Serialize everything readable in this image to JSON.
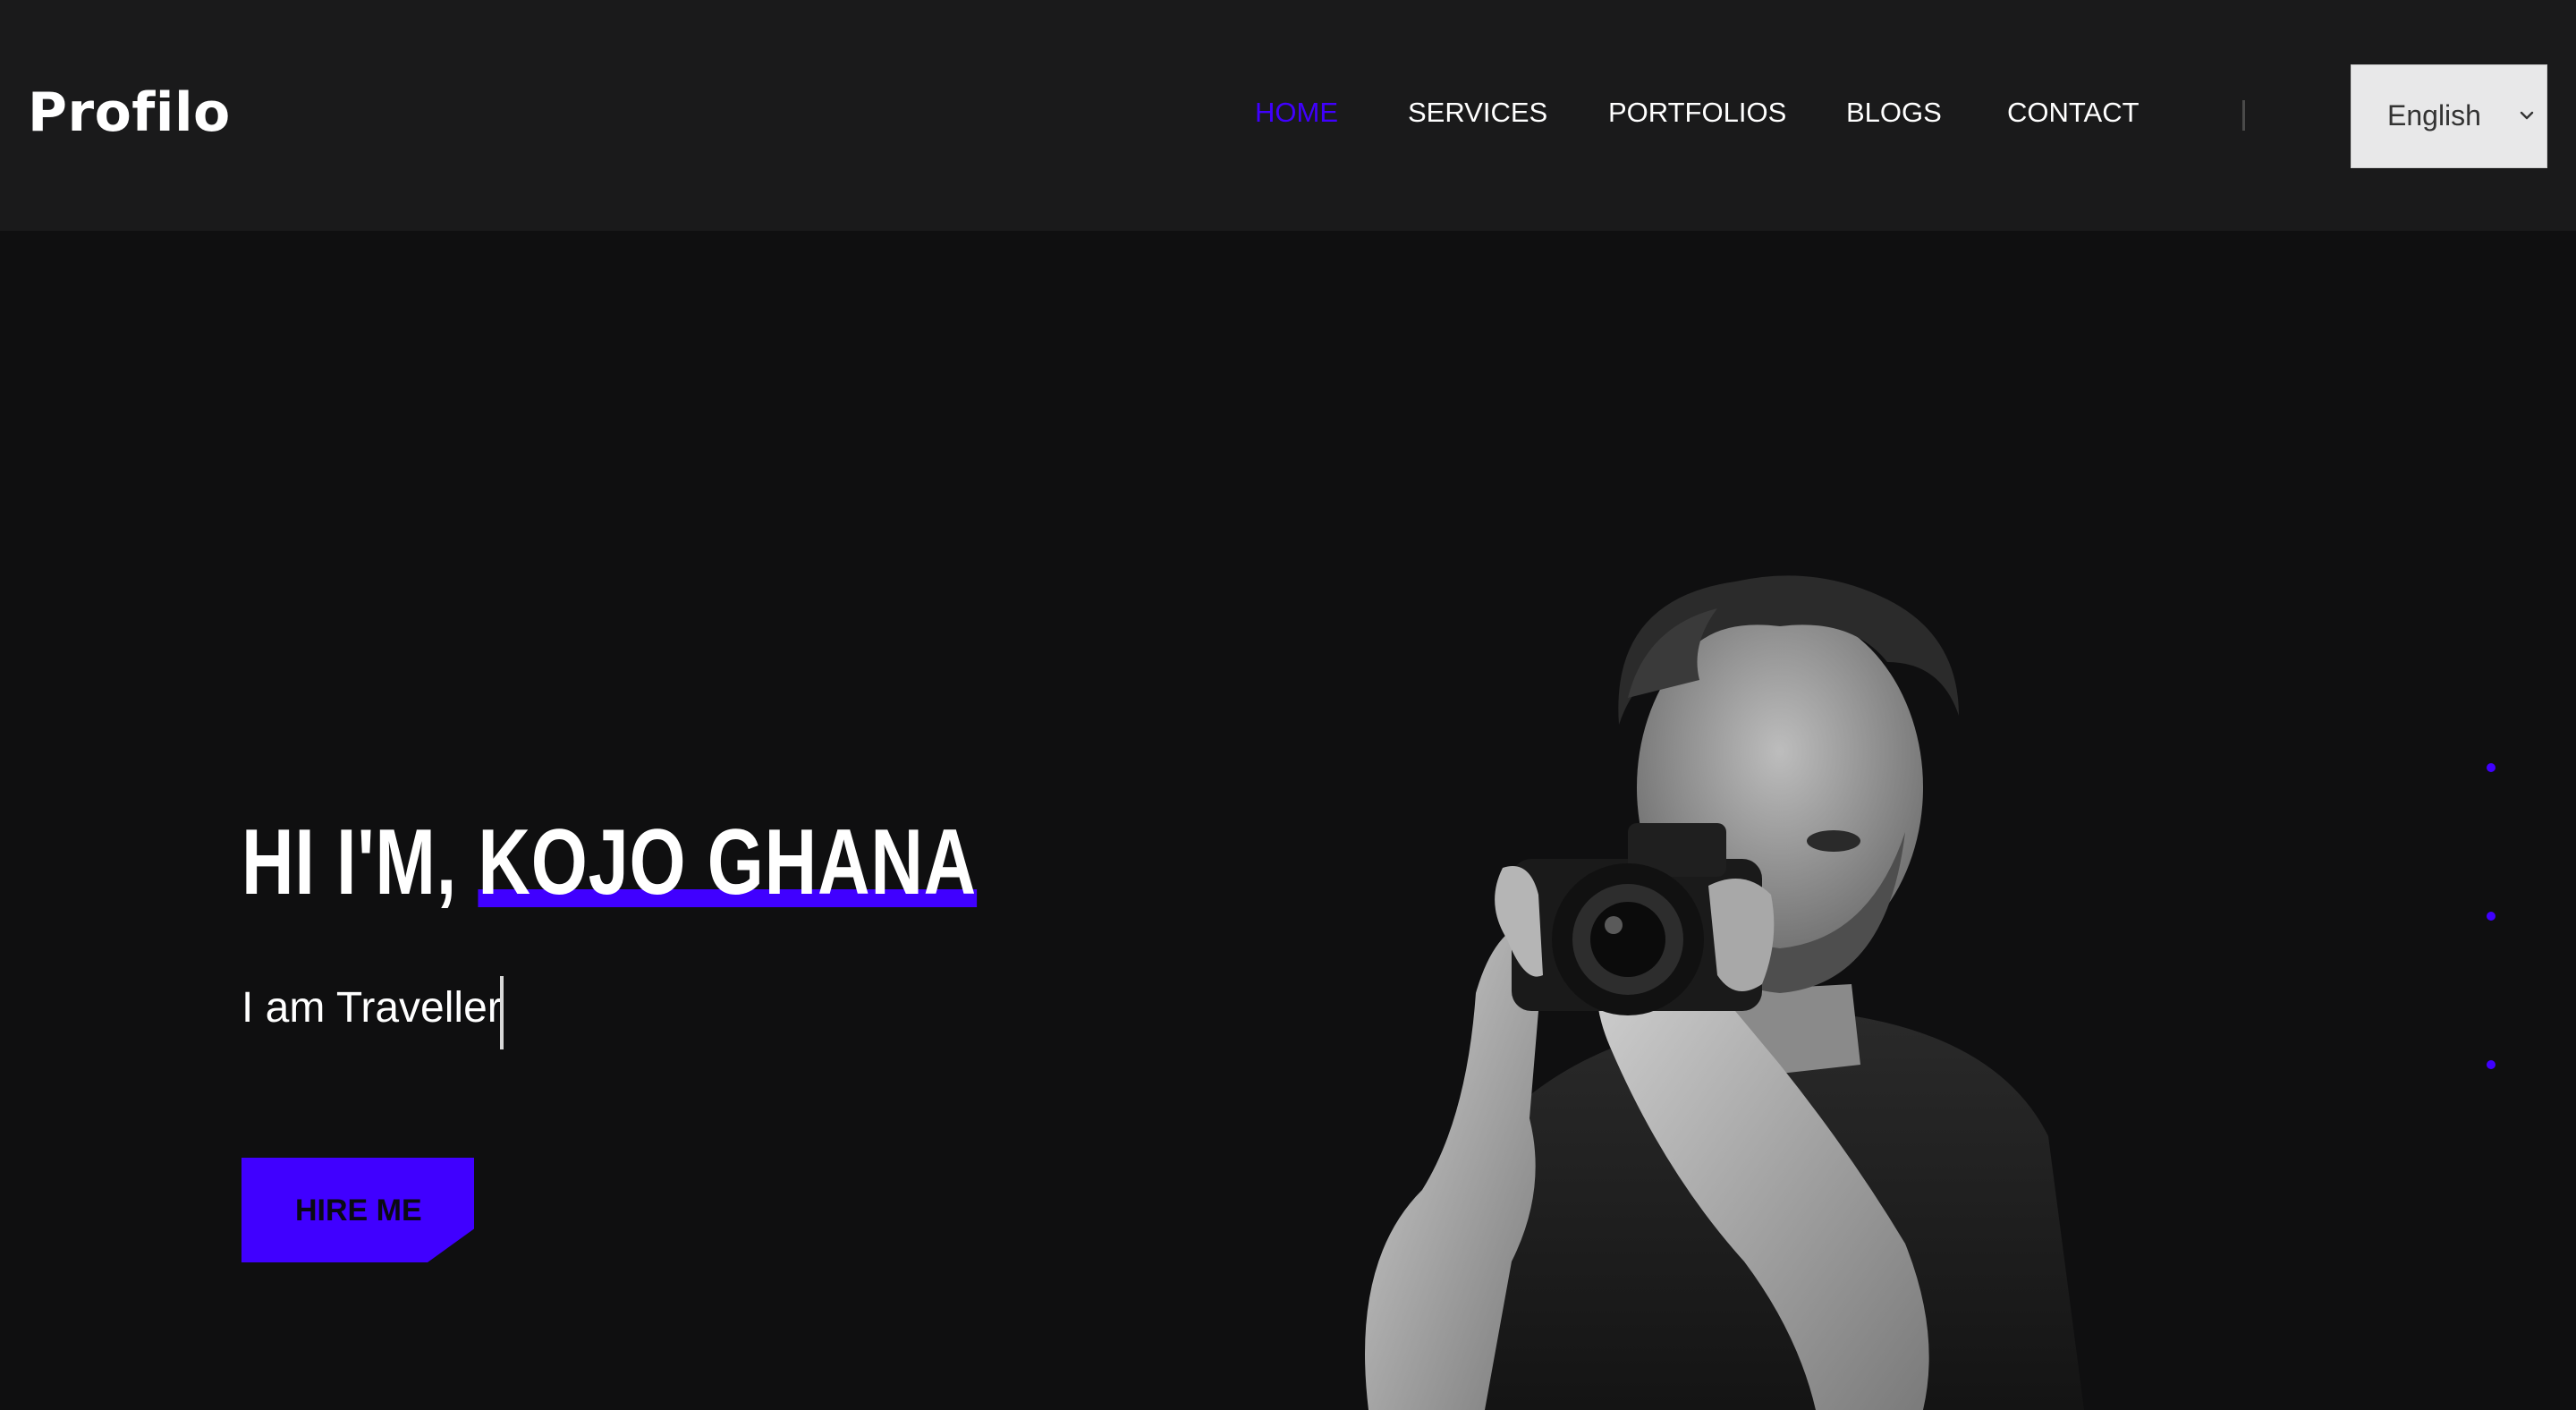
{
  "header": {
    "logo": "Profilo",
    "nav": [
      {
        "label": "HOME",
        "active": true
      },
      {
        "label": "SERVICES",
        "active": false
      },
      {
        "label": "PORTFOLIOS",
        "active": false
      },
      {
        "label": "BLOGS",
        "active": false
      },
      {
        "label": "CONTACT",
        "active": false
      }
    ],
    "language": {
      "selected": "English",
      "icon": "chevron-down-icon"
    }
  },
  "hero": {
    "greeting": "HI I'M,",
    "name": "KOJO GHANA",
    "subtitle": "I am Traveller",
    "cta_label": "HIRE ME",
    "image": "photographer-portrait"
  },
  "slider": {
    "dots_count": 3,
    "active_index": 0
  },
  "colors": {
    "accent": "#4000ff",
    "header_bg": "#1a1a1b",
    "page_bg": "#0f0f10",
    "text": "#ffffff"
  }
}
